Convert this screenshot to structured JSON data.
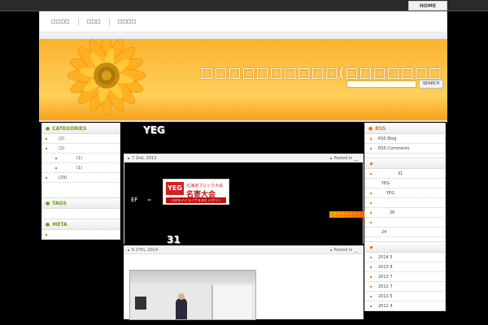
{
  "topbar": {
    "home_label": "HOME"
  },
  "nav": {
    "items": [
      "□□□□",
      "□□□",
      "□□□□"
    ]
  },
  "header": {
    "site_title": "□□□□□□□□□□(□□□□□□□",
    "search_placeholder": "",
    "search_button": "SEARCH"
  },
  "left_sidebar": {
    "categories_title": "CATEGORIES",
    "categories": [
      {
        "label": "",
        "count": "(2)",
        "indent": false
      },
      {
        "label": "",
        "count": "(2)",
        "indent": false
      },
      {
        "label": "",
        "count": "(1)",
        "indent": true
      },
      {
        "label": "",
        "count": "(1)",
        "indent": true
      },
      {
        "label": "",
        "count": "(29)",
        "indent": false
      }
    ],
    "tags_title": "TAGS",
    "meta_title": "META"
  },
  "posts": [
    {
      "title": "YEG",
      "date": "7  2nd, 2013",
      "posted_in": "Posted in __",
      "banner_stamp": "YEG",
      "banner_title": "名寄大会",
      "banner_head": "北海道ブロック大会",
      "banner_sub": "ユキもイイコノナヨヨロ ハマリン",
      "pre_a": "EF",
      "pre_b": "=",
      "number": "31",
      "ending": "・・・・・・・"
    },
    {
      "date": "6  27th, 2014",
      "posted_in": "Posted in __"
    }
  ],
  "right_sidebar": {
    "rss_title": "RSS",
    "rss_items": [
      "RSS Blog",
      "RSS Comments"
    ],
    "recent_items": [
      {
        "label": "31",
        "style": "ind"
      },
      {
        "label": "YEG",
        "style": "plain"
      },
      {
        "label": "YEG",
        "style": "ind"
      },
      {
        "label": "",
        "style": "dot"
      },
      {
        "label": "26",
        "style": "ind"
      },
      {
        "label": "",
        "style": "dot"
      },
      {
        "label": "24",
        "style": "plain"
      }
    ],
    "archives": [
      "2014 5",
      "2013 8",
      "2013 7",
      "2012 7",
      "2012 5",
      "2012 4"
    ]
  },
  "colors": {
    "accent_green": "#6a9a1a",
    "accent_orange": "#e07a10",
    "header_orange": "#fdc44a"
  }
}
